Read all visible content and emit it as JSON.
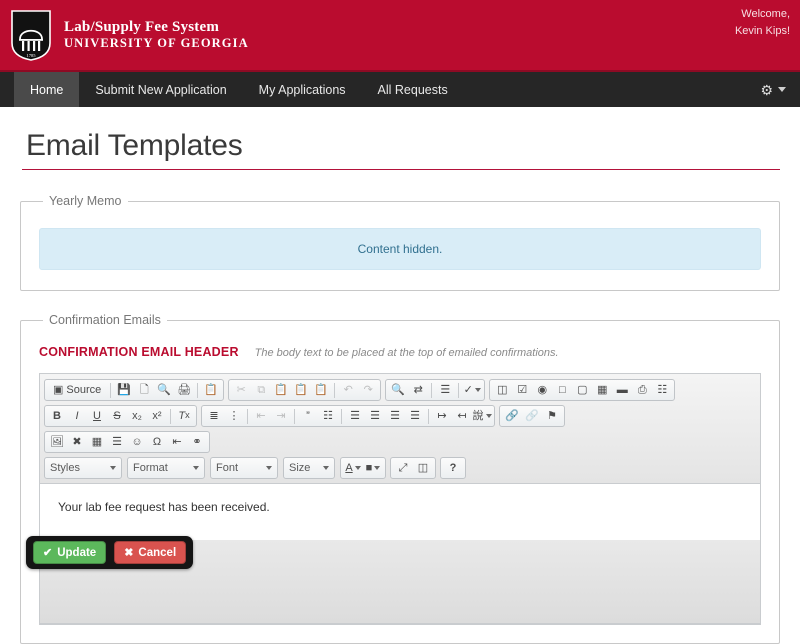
{
  "header": {
    "brand_title": "Lab/Supply Fee System",
    "brand_subtitle": "UNIVERSITY OF GEORGIA",
    "seal_year": "1785",
    "welcome_line1": "Welcome,",
    "welcome_line2": "Kevin Kips!",
    "brand_color": "#ba0c2f"
  },
  "nav": {
    "items": [
      {
        "label": "Home",
        "active": true
      },
      {
        "label": "Submit New Application",
        "active": false
      },
      {
        "label": "My Applications",
        "active": false
      },
      {
        "label": "All Requests",
        "active": false
      }
    ],
    "settings_icon": "gear-icon",
    "bar_color": "#262626"
  },
  "page": {
    "title": "Email Templates"
  },
  "yearly_memo": {
    "legend": "Yearly Memo",
    "notice": "Content hidden.",
    "notice_bg": "#d9edf7",
    "notice_color": "#31708f"
  },
  "confirmation_emails": {
    "legend": "Confirmation Emails",
    "field_label": "CONFIRMATION EMAIL HEADER",
    "field_label_color": "#ba0c2f",
    "field_help": "The body text to be placed at the top of emailed confirmations.",
    "editor": {
      "source_label": "Source",
      "content": "Your lab fee request has been received.",
      "combos": [
        {
          "name": "styles",
          "label": "Styles"
        },
        {
          "name": "format",
          "label": "Format"
        },
        {
          "name": "font",
          "label": "Font"
        },
        {
          "name": "size",
          "label": "Size"
        }
      ],
      "row1": {
        "group_a": [
          "source-icon",
          "save-icon",
          "new-page-icon",
          "preview-icon",
          "print-icon",
          "templates-icon"
        ],
        "group_b": [
          "cut-icon",
          "copy-icon",
          "paste-icon",
          "paste-text-icon",
          "paste-word-icon",
          "undo-icon",
          "redo-icon"
        ],
        "group_c": [
          "find-icon",
          "replace-icon",
          "select-all-icon",
          "spellcheck-icon"
        ],
        "group_d": [
          "form-icon",
          "checkbox-icon",
          "radio-icon",
          "textfield-icon",
          "textarea-icon",
          "select-icon",
          "button-icon",
          "imagebutton-icon",
          "hiddenfield-icon"
        ]
      },
      "row2": {
        "group_a": [
          "bold-icon",
          "italic-icon",
          "underline-icon",
          "strike-icon",
          "subscript-icon",
          "superscript-icon",
          "remove-format-icon"
        ],
        "group_b": [
          "numbered-list-icon",
          "bulleted-list-icon",
          "outdent-icon",
          "indent-icon",
          "blockquote-icon",
          "create-div-icon",
          "align-left-icon",
          "align-center-icon",
          "align-right-icon",
          "justify-icon",
          "ltr-icon",
          "rtl-icon",
          "language-icon"
        ],
        "group_c": [
          "link-icon",
          "unlink-icon",
          "anchor-icon"
        ]
      },
      "row3": {
        "group_a": [
          "image-icon",
          "flash-icon",
          "table-icon",
          "horizontal-rule-icon",
          "smiley-icon",
          "special-char-icon",
          "page-break-icon",
          "iframe-icon"
        ]
      },
      "row4": {
        "group_colors": [
          "text-color-icon",
          "bg-color-icon"
        ],
        "group_tools": [
          "maximize-icon",
          "show-blocks-icon"
        ],
        "group_about": [
          "about-icon"
        ]
      }
    },
    "actions": {
      "update_label": "Update",
      "cancel_label": "Cancel",
      "update_icon": "check-icon",
      "cancel_icon": "cross-icon",
      "update_color": "#5cb85c",
      "cancel_color": "#d9534f"
    }
  }
}
